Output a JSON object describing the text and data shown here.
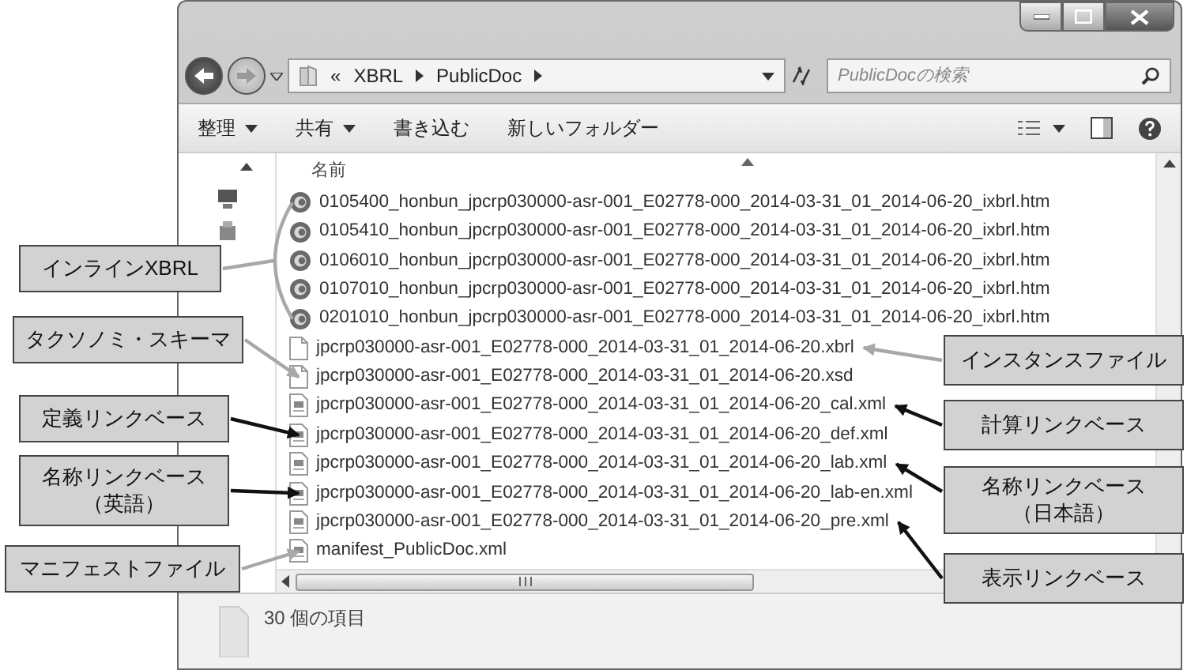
{
  "address_bar": {
    "overflow": "«",
    "crumbs": [
      "XBRL",
      "PublicDoc"
    ]
  },
  "search": {
    "placeholder": "PublicDocの検索"
  },
  "toolbar": {
    "items": [
      {
        "label": "整理",
        "dropdown": true
      },
      {
        "label": "共有",
        "dropdown": true
      },
      {
        "label": "書き込む",
        "dropdown": false
      },
      {
        "label": "新しいフォルダー",
        "dropdown": false
      }
    ]
  },
  "file_list": {
    "columns": [
      "名前"
    ],
    "files": [
      {
        "name": "0105400_honbun_jpcrp030000-asr-001_E02778-000_2014-03-31_01_2014-06-20_ixbrl.htm",
        "kind": "web"
      },
      {
        "name": "0105410_honbun_jpcrp030000-asr-001_E02778-000_2014-03-31_01_2014-06-20_ixbrl.htm",
        "kind": "web"
      },
      {
        "name": "0106010_honbun_jpcrp030000-asr-001_E02778-000_2014-03-31_01_2014-06-20_ixbrl.htm",
        "kind": "web"
      },
      {
        "name": "0107010_honbun_jpcrp030000-asr-001_E02778-000_2014-03-31_01_2014-06-20_ixbrl.htm",
        "kind": "web"
      },
      {
        "name": "0201010_honbun_jpcrp030000-asr-001_E02778-000_2014-03-31_01_2014-06-20_ixbrl.htm",
        "kind": "web"
      },
      {
        "name": "jpcrp030000-asr-001_E02778-000_2014-03-31_01_2014-06-20.xbrl",
        "kind": "blank"
      },
      {
        "name": "jpcrp030000-asr-001_E02778-000_2014-03-31_01_2014-06-20.xsd",
        "kind": "blank"
      },
      {
        "name": "jpcrp030000-asr-001_E02778-000_2014-03-31_01_2014-06-20_cal.xml",
        "kind": "xml"
      },
      {
        "name": "jpcrp030000-asr-001_E02778-000_2014-03-31_01_2014-06-20_def.xml",
        "kind": "xml"
      },
      {
        "name": "jpcrp030000-asr-001_E02778-000_2014-03-31_01_2014-06-20_lab.xml",
        "kind": "xml"
      },
      {
        "name": "jpcrp030000-asr-001_E02778-000_2014-03-31_01_2014-06-20_lab-en.xml",
        "kind": "xml"
      },
      {
        "name": "jpcrp030000-asr-001_E02778-000_2014-03-31_01_2014-06-20_pre.xml",
        "kind": "xml"
      },
      {
        "name": "manifest_PublicDoc.xml",
        "kind": "xml"
      }
    ]
  },
  "status_bar": {
    "text": "30 個の項目"
  },
  "callouts": [
    {
      "lines": [
        "インラインXBRL"
      ],
      "color": "#a8a8a8"
    },
    {
      "lines": [
        "タクソノミ・スキーマ"
      ],
      "color": "#a8a8a8"
    },
    {
      "lines": [
        "定義リンクベース"
      ],
      "color": "#111111"
    },
    {
      "lines": [
        "名称リンクベース",
        "（英語）"
      ],
      "color": "#111111"
    },
    {
      "lines": [
        "マニフェストファイル"
      ],
      "color": "#a8a8a8"
    },
    {
      "lines": [
        "インスタンスファイル"
      ],
      "color": "#a8a8a8"
    },
    {
      "lines": [
        "計算リンクベース"
      ],
      "color": "#111111"
    },
    {
      "lines": [
        "名称リンクベース",
        "（日本語）"
      ],
      "color": "#111111"
    },
    {
      "lines": [
        "表示リンクベース"
      ],
      "color": "#111111"
    }
  ]
}
